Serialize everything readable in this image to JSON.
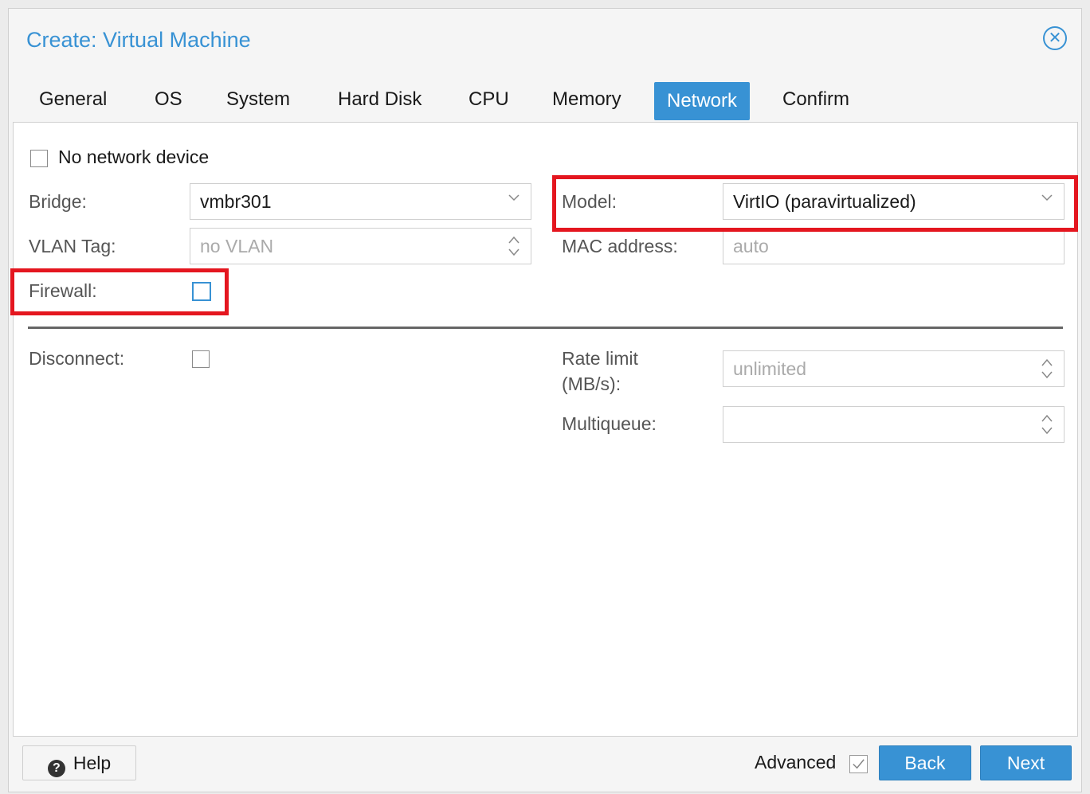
{
  "window": {
    "title": "Create: Virtual Machine"
  },
  "tabs": [
    {
      "label": "General"
    },
    {
      "label": "OS"
    },
    {
      "label": "System"
    },
    {
      "label": "Hard Disk"
    },
    {
      "label": "CPU"
    },
    {
      "label": "Memory"
    },
    {
      "label": "Network",
      "active": true
    },
    {
      "label": "Confirm"
    }
  ],
  "form": {
    "no_network_device": {
      "label": "No network device",
      "checked": false
    },
    "bridge": {
      "label": "Bridge:",
      "value": "vmbr301"
    },
    "vlan_tag": {
      "label": "VLAN Tag:",
      "placeholder": "no VLAN"
    },
    "firewall": {
      "label": "Firewall:",
      "checked": false
    },
    "model": {
      "label": "Model:",
      "value": "VirtIO (paravirtualized)"
    },
    "mac_address": {
      "label": "MAC address:",
      "placeholder": "auto"
    },
    "disconnect": {
      "label": "Disconnect:",
      "checked": false
    },
    "rate_limit": {
      "label_line1": "Rate limit",
      "label_line2": "(MB/s):",
      "placeholder": "unlimited"
    },
    "multiqueue": {
      "label": "Multiqueue:",
      "value": ""
    }
  },
  "footer": {
    "help_label": "Help",
    "help_icon": "?",
    "advanced_label": "Advanced",
    "advanced_checked": true,
    "back_label": "Back",
    "next_label": "Next"
  },
  "colors": {
    "accent": "#3892d4",
    "highlight": "#e4161f"
  }
}
